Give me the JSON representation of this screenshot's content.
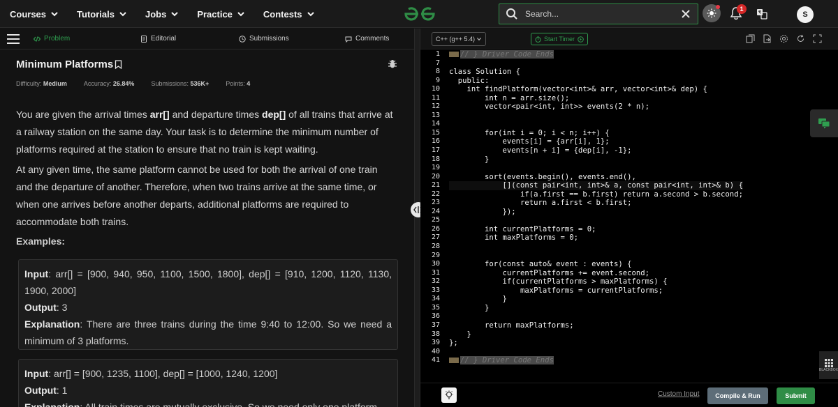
{
  "nav": {
    "items": [
      {
        "label": "Courses"
      },
      {
        "label": "Tutorials"
      },
      {
        "label": "Jobs"
      },
      {
        "label": "Practice"
      },
      {
        "label": "Contests"
      }
    ],
    "search_placeholder": "Search...",
    "notification_count": "1",
    "avatar_letter": "S",
    "brand_color": "#2f8d46"
  },
  "tabs": {
    "problem": "Problem",
    "editorial": "Editorial",
    "submissions": "Submissions",
    "comments": "Comments"
  },
  "problem": {
    "title": "Minimum Platforms",
    "difficulty_label": "Difficulty:",
    "difficulty": "Medium",
    "accuracy_label": "Accuracy:",
    "accuracy": "26.84%",
    "submissions_label": "Submissions:",
    "submissions": "536K+",
    "points_label": "Points:",
    "points": "4",
    "desc1_a": "You are given the arrival times ",
    "desc1_arr": "arr[]",
    "desc1_b": " and departure times ",
    "desc1_dep": "dep[]",
    "desc1_c": " of all trains that arrive at a railway station on the same day. Your task is to determine the minimum number of platforms required at the station to ensure that no train is kept waiting.",
    "desc2": "At any given time, the same platform cannot be used for both the arrival of one train and the departure of another. Therefore, when two trains arrive at the same time, or when one arrives before another departs, additional platforms are required to accommodate both trains.",
    "examples_heading": "Examples:",
    "ex1_input_label": "Input",
    "ex1_input": ": arr[] = [900, 940, 950, 1100, 1500, 1800], dep[] = [910, 1200, 1120, 1130, 1900, 2000]",
    "ex1_output_label": "Output",
    "ex1_output": ": 3",
    "ex1_expl_label": "Explanation",
    "ex1_expl": ": There are three trains during the time 9:40 to 12:00. So we need a minimum of 3 platforms.",
    "ex2_input_label": "Input",
    "ex2_input": ": arr[] = [900, 1235, 1100], dep[] = [1000, 1240, 1200]",
    "ex2_output_label": "Output",
    "ex2_output": ": 1",
    "ex2_expl_label": "Explanation",
    "ex2_expl": ": All train times are mutually exclusive. So we need only one platform"
  },
  "editor": {
    "language": "C++ (g++ 5.4)",
    "timer_label": "Start Timer",
    "line_numbers": [
      "1",
      "7",
      "8",
      "9",
      "10",
      "11",
      "12",
      "13",
      "14",
      "15",
      "16",
      "17",
      "18",
      "19",
      "20",
      "21",
      "22",
      "23",
      "24",
      "25",
      "26",
      "27",
      "28",
      "29",
      "30",
      "31",
      "32",
      "33",
      "34",
      "35",
      "36",
      "37",
      "38",
      "39",
      "40",
      "41"
    ],
    "code_lines": [
      "// } Driver Code Ends",
      "",
      "class Solution {",
      "  public:",
      "    int findPlatform(vector<int>& arr, vector<int>& dep) {",
      "        int n = arr.size();",
      "        vector<pair<int, int>> events(2 * n);",
      "",
      "",
      "        for(int i = 0; i < n; i++) {",
      "            events[i] = {arr[i], 1};",
      "            events[n + i] = {dep[i], -1};",
      "        }",
      "",
      "        sort(events.begin(), events.end(),",
      "            [](const pair<int, int>& a, const pair<int, int>& b) {",
      "                if(a.first == b.first) return a.second > b.second;",
      "                return a.first < b.first;",
      "            });",
      "",
      "        int currentPlatforms = 0;",
      "        int maxPlatforms = 0;",
      "",
      "",
      "        for(const auto& event : events) {",
      "            currentPlatforms += event.second;",
      "            if(currentPlatforms > maxPlatforms) {",
      "                maxPlatforms = currentPlatforms;",
      "            }",
      "        }",
      "",
      "        return maxPlatforms;",
      "    }",
      "};",
      "",
      "// } Driver Code Ends"
    ],
    "custom_input": "Custom Input",
    "compile_run": "Compile & Run",
    "submit": "Submit",
    "blackbox_label": "BLACKBOX"
  }
}
